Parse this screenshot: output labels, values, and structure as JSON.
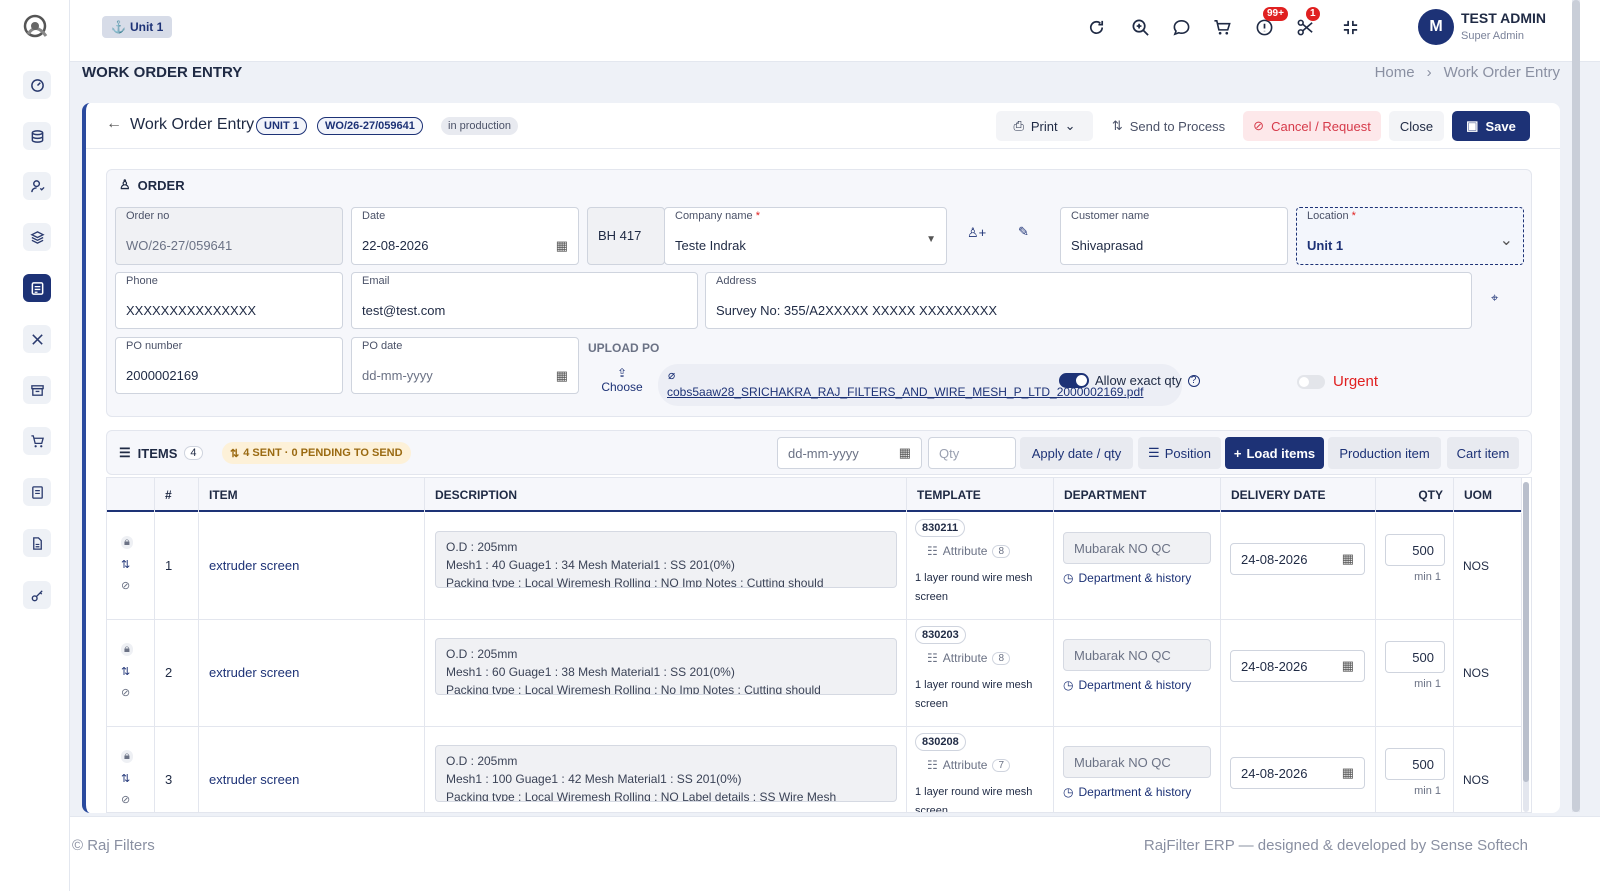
{
  "topbar": {
    "unit_label": "Unit 1",
    "notif_badge": "99+",
    "tools_badge": "1",
    "avatar_letter": "M",
    "user_name": "TEST ADMIN",
    "user_role": "Super Admin"
  },
  "page": {
    "title": "WORK ORDER ENTRY",
    "breadcrumb": [
      "Home",
      "Work Order Entry"
    ]
  },
  "header": {
    "title": "Work Order Entry",
    "unit_pill": "UNIT 1",
    "wo_pill": "WO/26-27/059641",
    "status_pill": "in production",
    "print_label": "Print",
    "send_label": "Send to Process",
    "cancel_label": "Cancel / Request",
    "close_label": "Close",
    "save_label": "Save"
  },
  "order": {
    "section_label": "ORDER",
    "order_no_label": "Order no",
    "order_no": "WO/26-27/059641",
    "date_label": "Date",
    "date": "22-08-2026",
    "code": "BH 417",
    "company_label": "Company name",
    "company": "Teste Indrak",
    "customer_label": "Customer name",
    "customer": "Shivaprasad",
    "location_label": "Location",
    "location": "Unit 1",
    "phone_label": "Phone",
    "phone": "XXXXXXXXXXXXXXX",
    "email_label": "Email",
    "email": "test@test.com",
    "address_label": "Address",
    "address": "Survey No: 355/A2XXXXX XXXXX XXXXXXXXX",
    "po_number_label": "PO number",
    "po_number": "2000002169",
    "po_date_label": "PO date",
    "po_date": "dd-mm-yyyy",
    "upload_label": "UPLOAD PO",
    "choose_label": "Choose",
    "file_name": "cobs5aaw28_SRICHAKRA_RAJ_FILTERS_AND_WIRE_MESH_P_LTD_2000002169.pdf",
    "allow_exact_label": "Allow exact qty",
    "urgent_label": "Urgent"
  },
  "items": {
    "section_label": "ITEMS",
    "count": "4",
    "sent_summary": "4 SENT · 0 PENDING TO SEND",
    "date_placeholder": "dd-mm-yyyy",
    "qty_placeholder": "Qty",
    "apply_label": "Apply date / qty",
    "position_label": "Position",
    "load_label": "Load items",
    "production_label": "Production item",
    "cart_label": "Cart item",
    "columns": [
      "#",
      "ITEM",
      "DESCRIPTION",
      "TEMPLATE",
      "DEPARTMENT",
      "DELIVERY DATE",
      "QTY",
      "UOM"
    ],
    "rows": [
      {
        "num": "1",
        "item": "extruder screen",
        "desc1": "O.D : 205mm",
        "desc2": "Mesh1 : 40  Guage1 : 34  Mesh Material1 : SS 201(0%)",
        "desc3": "Packing type  : Local   Wiremesh Rolling : NO  Imp Notes  : Cutting should",
        "template": "830211",
        "attr_label": "Attribute",
        "attr_count": "8",
        "template_desc": "1 layer round wire mesh screen",
        "department": "Mubarak NO QC",
        "dept_link": "Department & history",
        "delivery": "24-08-2026",
        "qty": "500",
        "min": "min 1",
        "uom": "NOS"
      },
      {
        "num": "2",
        "item": "extruder screen",
        "desc1": "O.D : 205mm",
        "desc2": "Mesh1 : 60  Guage1 : 38  Mesh Material1 : SS 201(0%)",
        "desc3": "Packing type  : Local  Wiremesh Rolling :  No Imp Notes  : Cutting should",
        "template": "830203",
        "attr_label": "Attribute",
        "attr_count": "8",
        "template_desc": "1 layer round wire mesh screen",
        "department": "Mubarak NO QC",
        "dept_link": "Department & history",
        "delivery": "24-08-2026",
        "qty": "500",
        "min": "min 1",
        "uom": "NOS"
      },
      {
        "num": "3",
        "item": "extruder screen",
        "desc1": "O.D : 205mm",
        "desc2": "Mesh1 : 100  Guage1 : 42  Mesh Material1 : SS 201(0%)",
        "desc3": "Packing type  : Local  Wiremesh Rolling : NO Label details : SS Wire Mesh",
        "template": "830208",
        "attr_label": "Attribute",
        "attr_count": "7",
        "template_desc": "1 layer round wire mesh screen",
        "department": "Mubarak NO QC",
        "dept_link": "Department & history",
        "delivery": "24-08-2026",
        "qty": "500",
        "min": "min 1",
        "uom": "NOS"
      }
    ]
  },
  "footer": {
    "left": "© Raj Filters",
    "right": "RajFilter ERP — designed & developed by Sense Softech"
  },
  "colors": {
    "primary": "#1d3276",
    "danger": "#e02020",
    "cancel_bg": "#fde8ea",
    "sent_bg": "#fdf1d8",
    "sent_text": "#9a6a12"
  }
}
